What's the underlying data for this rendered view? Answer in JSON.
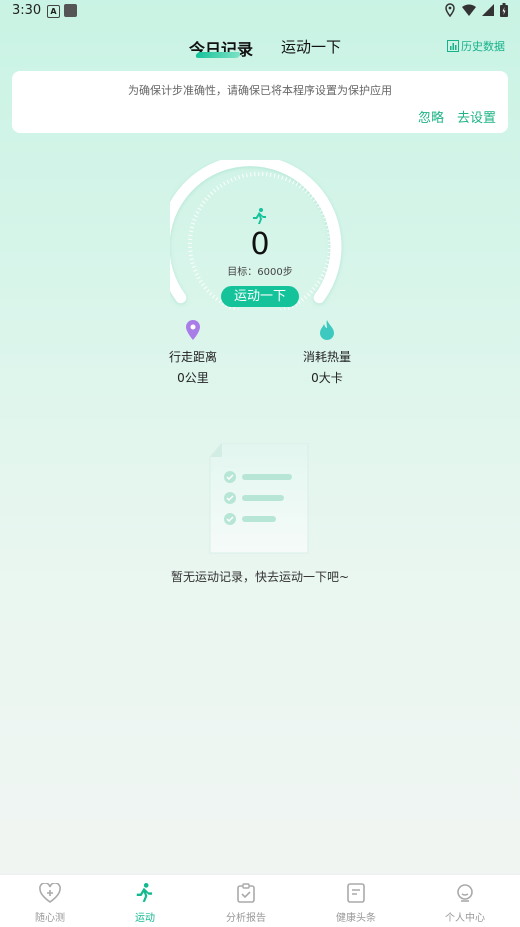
{
  "status_bar": {
    "time": "3:30",
    "notif_letter": "A"
  },
  "tabs": [
    {
      "label": "今日记录",
      "active": true
    },
    {
      "label": "运动一下",
      "active": false
    }
  ],
  "history_label": "历史数据",
  "notice": {
    "text": "为确保计步准确性，请确保已将本程序设置为保护应用",
    "ignore_label": "忽略",
    "set_label": "去设置"
  },
  "steps": {
    "count": "0",
    "goal_text": "目标：6000步",
    "progress": 0,
    "button_label": "运动一下"
  },
  "stats": {
    "distance": {
      "label": "行走距离",
      "value": "0公里"
    },
    "calories": {
      "label": "消耗热量",
      "value": "0大卡"
    }
  },
  "empty_state": {
    "text": "暂无运动记录，快去运动一下吧~"
  },
  "bottom_nav": [
    {
      "label": "随心测",
      "icon": "heart-plus-icon",
      "active": false
    },
    {
      "label": "运动",
      "icon": "running-icon",
      "active": true
    },
    {
      "label": "分析报告",
      "icon": "clipboard-check-icon",
      "active": false
    },
    {
      "label": "健康头条",
      "icon": "news-icon",
      "active": false
    },
    {
      "label": "个人中心",
      "icon": "person-icon",
      "active": false
    }
  ],
  "colors": {
    "accent": "#15c39a",
    "active_nav": "#14b88f",
    "pin": "#a97de8",
    "flame": "#3ec9c0"
  }
}
